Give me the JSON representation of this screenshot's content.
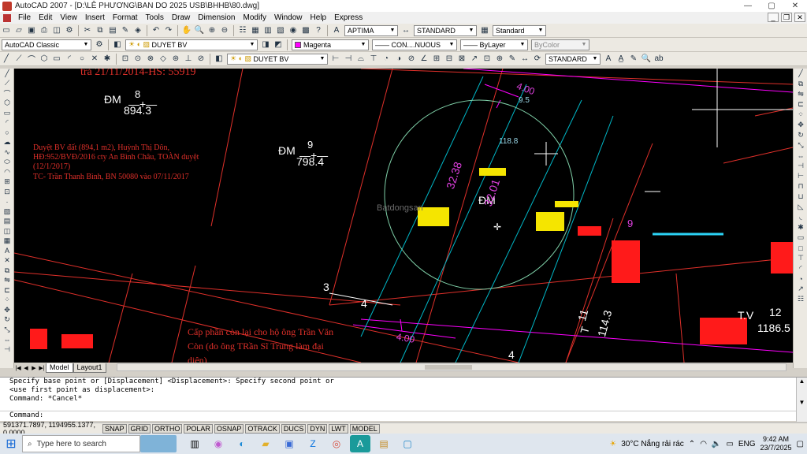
{
  "window": {
    "title": "AutoCAD 2007 - [D:\\LÊ PHƯƠNG\\BAN DO 2025 USB\\BHHB\\80.dwg]",
    "controls": [
      "—",
      "▢",
      "✕"
    ]
  },
  "menu": {
    "items": [
      "File",
      "Edit",
      "View",
      "Insert",
      "Format",
      "Tools",
      "Draw",
      "Dimension",
      "Modify",
      "Window",
      "Help",
      "Express"
    ]
  },
  "toolbar1": {
    "text_style": "APTIMA",
    "dim_style": "STANDARD",
    "table_style": "Standard"
  },
  "toolbar2": {
    "workspace": "AutoCAD Classic",
    "layer": "DUYET BV",
    "color": "Magenta",
    "color_hex": "#ff00ff",
    "linetype": "CON....NUOUS",
    "lineweight": "ByLayer",
    "plotstyle": "ByColor"
  },
  "toolbar3": {
    "layer": "DUYET BV",
    "text_style": "STANDARD"
  },
  "drawing": {
    "top_red_note": "trả 21/11/2014-HS: 55919",
    "parcel8_label": "ĐM",
    "parcel8_num": "8",
    "parcel8_area": "894.3",
    "parcel9_label": "ĐM",
    "parcel9_num": "9",
    "parcel9_area": "798.4",
    "red_note_lines": [
      "Duyệt BV đất (894,1 m2), Huỳnh Thị Dôn,",
      "HĐ:952/BVĐ/2016 cty An Bình Châu, TOÀN duyệt",
      "(12/1/2017)",
      "TC- Trần Thanh Bình, BN 50080 vào 07/11/2017"
    ],
    "center_label": "ĐM",
    "dim_32_38": "32.38",
    "dim_32_01": "32.01",
    "dim_118_8": "118.8",
    "dim_9_5": "9.5",
    "dim_4_00_top": "4.00",
    "dim_4_00_bottom": "4.00",
    "num_3": "3",
    "num_4": "4",
    "num_4_bottom": "4",
    "num_9_small": "9",
    "parcel11_label": "T",
    "parcel11_num": "11",
    "parcel11_area": "114.3",
    "parcel12_label": "T.V",
    "parcel12_num": "12",
    "parcel12_area": "1186.5",
    "bottom_red_note_lines": [
      "Cấp phần còn lại cho hộ ông Trần Văn",
      "Còn (do ông TRần Sĩ Trung làm đại",
      "diện)"
    ],
    "watermark": "Batdongsan"
  },
  "tabs": [
    "Model",
    "Layout1"
  ],
  "command": {
    "history": [
      "Specify base point or [Displacement] <Displacement>: Specify second point or",
      "<use first point as displacement>:",
      "Command: *Cancel*"
    ],
    "prompt": "Command:"
  },
  "status": {
    "coords": "591371.7897, 1194955.1377, 0.0000",
    "toggles": [
      "SNAP",
      "GRID",
      "ORTHO",
      "POLAR",
      "OSNAP",
      "OTRACK",
      "DUCS",
      "DYN",
      "LWT",
      "MODEL"
    ]
  },
  "taskbar": {
    "search_placeholder": "Type here to search",
    "weather": "30°C  Nắng rải rác",
    "lang": "ENG",
    "time": "9:42 AM",
    "date": "23/7/2025"
  }
}
